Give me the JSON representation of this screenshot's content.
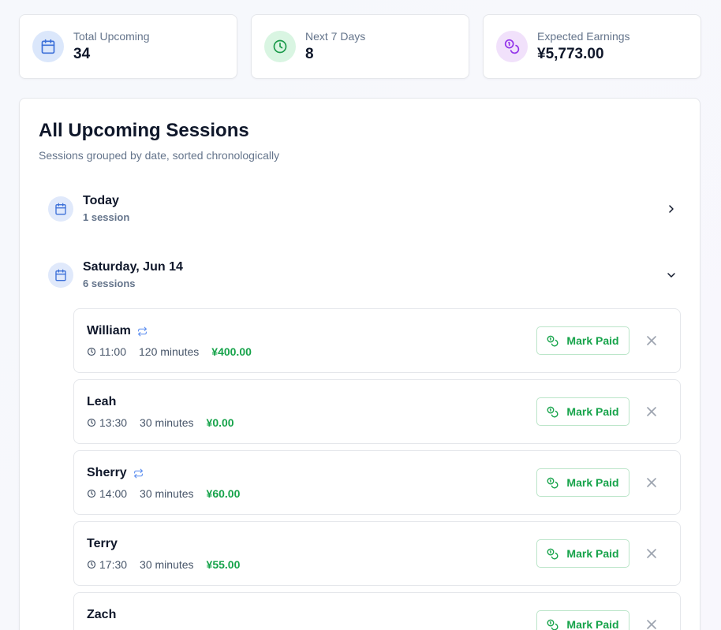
{
  "stats": [
    {
      "label": "Total Upcoming",
      "value": "34",
      "icon": "calendar-icon",
      "icon_bg": "#dbe7fb",
      "icon_color": "#3b6fd8"
    },
    {
      "label": "Next 7 Days",
      "value": "8",
      "icon": "clock-icon",
      "icon_bg": "#d9f5e2",
      "icon_color": "#1a9a4a"
    },
    {
      "label": "Expected Earnings",
      "value": "¥5,773.00",
      "icon": "coins-icon",
      "icon_bg": "#f1e1fb",
      "icon_color": "#9333ea"
    }
  ],
  "main": {
    "title": "All Upcoming Sessions",
    "subtitle": "Sessions grouped by date, sorted chronologically"
  },
  "groups": [
    {
      "title": "Today",
      "count": "1 session",
      "expanded": false
    },
    {
      "title": "Saturday, Jun 14",
      "count": "6 sessions",
      "expanded": true
    }
  ],
  "sessions": [
    {
      "name": "William",
      "recurring": true,
      "time": "11:00",
      "duration": "120 minutes",
      "amount": "¥400.00"
    },
    {
      "name": "Leah",
      "recurring": false,
      "time": "13:30",
      "duration": "30 minutes",
      "amount": "¥0.00"
    },
    {
      "name": "Sherry",
      "recurring": true,
      "time": "14:00",
      "duration": "30 minutes",
      "amount": "¥60.00"
    },
    {
      "name": "Terry",
      "recurring": false,
      "time": "17:30",
      "duration": "30 minutes",
      "amount": "¥55.00"
    },
    {
      "name": "Zach",
      "recurring": false,
      "time": "",
      "duration": "",
      "amount": ""
    }
  ],
  "actions": {
    "mark_paid_label": "Mark Paid"
  },
  "colors": {
    "accent_green": "#16a34a",
    "accent_blue": "#3b6fd8",
    "accent_purple": "#9333ea"
  }
}
